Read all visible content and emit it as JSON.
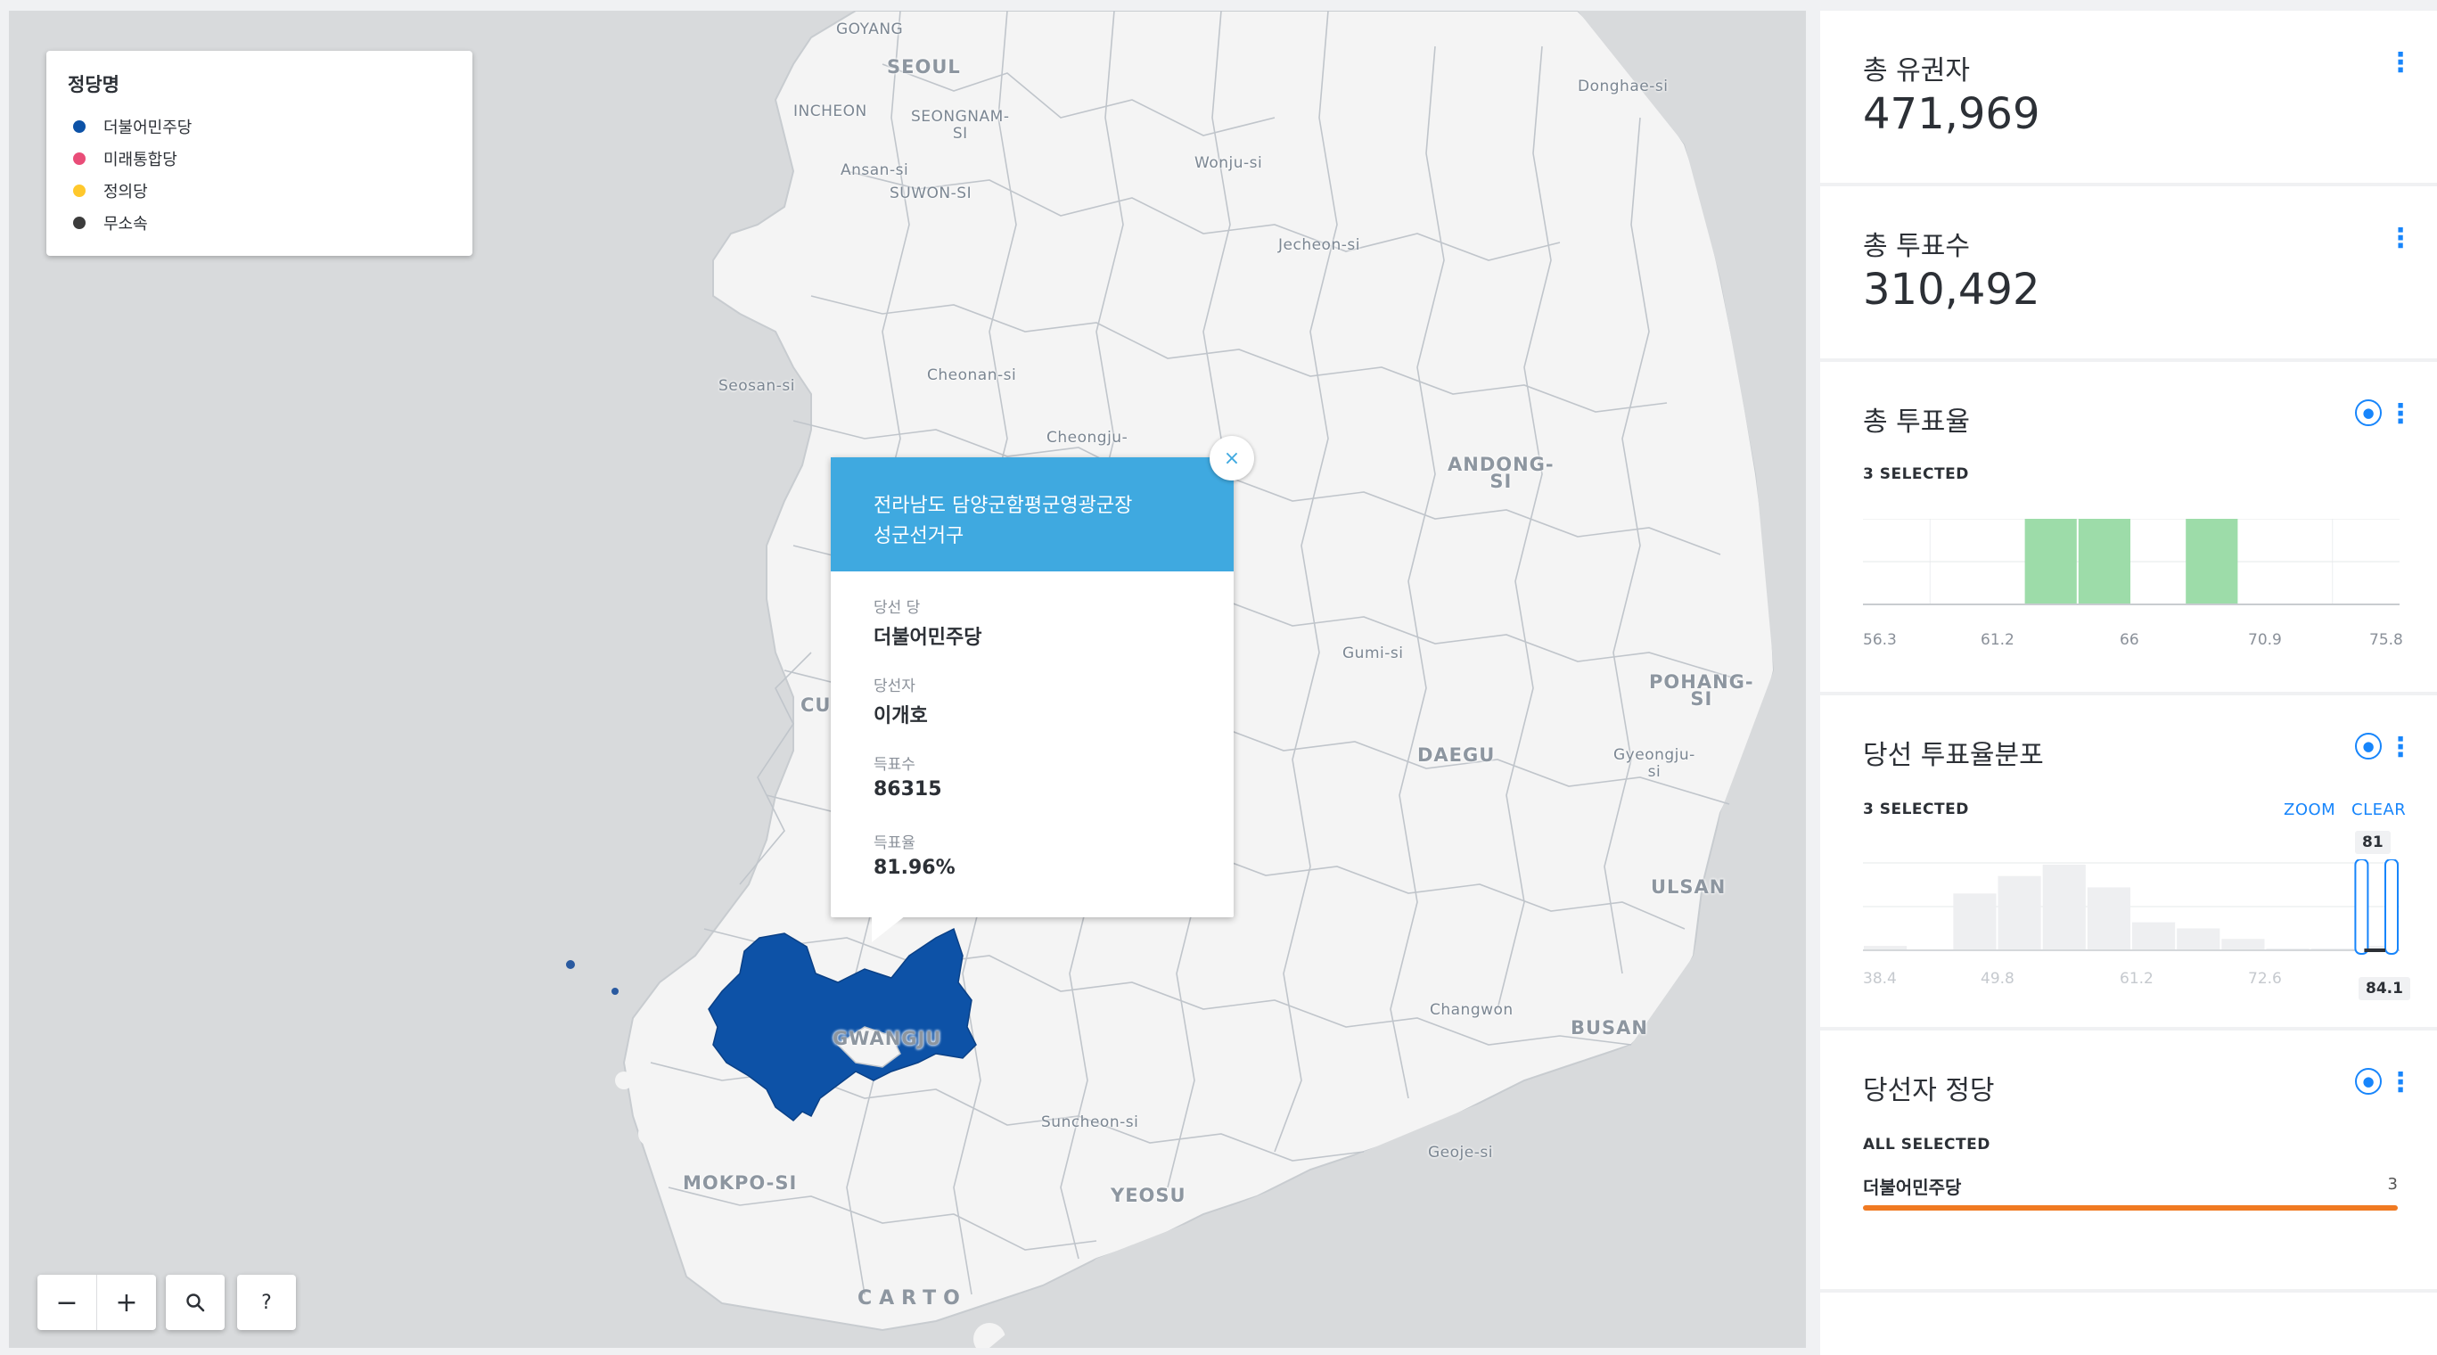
{
  "map": {
    "city_labels": [
      {
        "text": "GOYANG"
      },
      {
        "text": "SEOUL"
      },
      {
        "text": "INCHEON"
      },
      {
        "text": "SEONGNAM-\nSI"
      },
      {
        "text": "Ansan-si"
      },
      {
        "text": "SUWON-SI"
      },
      {
        "text": "Wonju-si"
      },
      {
        "text": "Donghae-si"
      },
      {
        "text": "Jecheon-si"
      },
      {
        "text": "Seosan-si"
      },
      {
        "text": "Cheonan-si"
      },
      {
        "text": "Cheongju-"
      },
      {
        "text": "ANDONG-\nSI"
      },
      {
        "text": "Gumi-si"
      },
      {
        "text": "POHANG-\nSI"
      },
      {
        "text": "Gyeongju-\nsi"
      },
      {
        "text": "DAEGU"
      },
      {
        "text": "CU"
      },
      {
        "text": "ULSAN"
      },
      {
        "text": "Changwon"
      },
      {
        "text": "BUSAN"
      },
      {
        "text": "GWANGJU"
      },
      {
        "text": "Suncheon-si"
      },
      {
        "text": "Geoje-si"
      },
      {
        "text": "YEOSU"
      },
      {
        "text": "MOKPO-SI"
      }
    ],
    "attribution": "CARTO"
  },
  "legend": {
    "title": "정당명",
    "items": [
      {
        "label": "더불어민주당",
        "color": "#0d52a7"
      },
      {
        "label": "미래통합당",
        "color": "#e94d78"
      },
      {
        "label": "정의당",
        "color": "#ffc82c"
      },
      {
        "label": "무소속",
        "color": "#3c3c3c"
      }
    ]
  },
  "controls": {
    "zoom_out": "−",
    "zoom_in": "+",
    "search_icon": "search-icon",
    "help": "?"
  },
  "popup": {
    "title_line1": "전라남도 담양군함평군영광군장",
    "title_line2": "성군선거구",
    "close": "×",
    "fields": [
      {
        "label": "당선 당",
        "value": "더불어민주당"
      },
      {
        "label": "당선자",
        "value": "이개호"
      },
      {
        "label": "득표수",
        "value": "86315"
      },
      {
        "label": "득표율",
        "value": "81.96%"
      }
    ]
  },
  "widgets": {
    "voters": {
      "title": "총 유권자",
      "value": "471,969"
    },
    "votes": {
      "title": "총 투표수",
      "value": "310,492"
    },
    "turnout": {
      "title": "총 투표율",
      "selected": "3 SELECTED",
      "axis": [
        "56.3",
        "61.2",
        "66",
        "70.9",
        "75.8"
      ]
    },
    "winner_rate": {
      "title": "당선 투표율분포",
      "selected": "3 SELECTED",
      "zoom": "ZOOM",
      "clear": "CLEAR",
      "axis": [
        "38.4",
        "49.8",
        "61.2",
        "72.6"
      ],
      "range_min": "81",
      "range_max": "84.1"
    },
    "winner_party": {
      "title": "당선자 정당",
      "selected": "ALL SELECTED",
      "rows": [
        {
          "label": "더불어민주당",
          "count": "3"
        }
      ],
      "bar_color": "#f07a22"
    }
  },
  "chart_data": [
    {
      "type": "bar",
      "title": "총 투표율",
      "x_ticks": [
        56.3,
        61.2,
        66,
        70.9,
        75.8
      ],
      "bins": [
        {
          "from": 56.3,
          "to": 58.25,
          "value": 0,
          "selected": false
        },
        {
          "from": 58.25,
          "to": 60.2,
          "value": 0,
          "selected": false
        },
        {
          "from": 60.2,
          "to": 62.15,
          "value": 0,
          "selected": false
        },
        {
          "from": 62.15,
          "to": 64.1,
          "value": 1,
          "selected": true
        },
        {
          "from": 64.1,
          "to": 66.05,
          "value": 1,
          "selected": true
        },
        {
          "from": 66.05,
          "to": 68.0,
          "value": 0,
          "selected": false
        },
        {
          "from": 68.0,
          "to": 69.95,
          "value": 1,
          "selected": true
        },
        {
          "from": 69.95,
          "to": 71.9,
          "value": 0,
          "selected": false
        },
        {
          "from": 71.9,
          "to": 73.85,
          "value": 0,
          "selected": false
        },
        {
          "from": 73.85,
          "to": 75.8,
          "value": 0,
          "selected": false
        }
      ],
      "ylim": [
        0,
        1
      ],
      "selected_color": "#9ddca9"
    },
    {
      "type": "bar",
      "title": "당선 투표율분포",
      "x_ticks": [
        38.4,
        49.8,
        61.2,
        72.6
      ],
      "bins": [
        {
          "from": 38.4,
          "to": 42.2,
          "value": 0.05
        },
        {
          "from": 42.2,
          "to": 46.0,
          "value": 0
        },
        {
          "from": 46.0,
          "to": 49.8,
          "value": 0.65
        },
        {
          "from": 49.8,
          "to": 53.6,
          "value": 0.85
        },
        {
          "from": 53.6,
          "to": 57.4,
          "value": 0.98
        },
        {
          "from": 57.4,
          "to": 61.2,
          "value": 0.72
        },
        {
          "from": 61.2,
          "to": 65.0,
          "value": 0.32
        },
        {
          "from": 65.0,
          "to": 68.8,
          "value": 0.25
        },
        {
          "from": 68.8,
          "to": 72.6,
          "value": 0.13
        },
        {
          "from": 72.6,
          "to": 76.4,
          "value": 0.02
        },
        {
          "from": 76.4,
          "to": 80.2,
          "value": 0.02
        },
        {
          "from": 80.2,
          "to": 84.0,
          "value": 0.05
        }
      ],
      "ylim": [
        0,
        1
      ],
      "selection": [
        81,
        84.1
      ]
    }
  ]
}
